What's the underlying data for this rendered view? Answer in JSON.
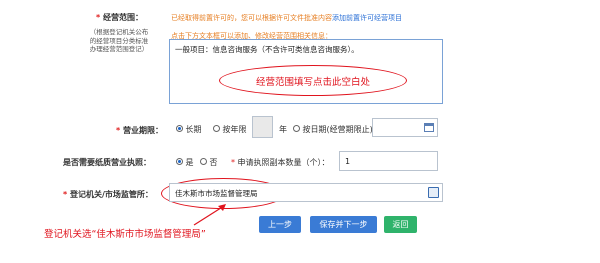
{
  "scope": {
    "label": "经营范围：",
    "note": "已经取得前置许可的，您可以根据许可文件批准内容",
    "note_link": "添加前置许可经营项目",
    "hint": "点击下方文本框可以添加、修改经营范围相关信息：",
    "side_tips": [
      "（根据登记机关公布",
      "的经营项目分类标准",
      "办理经营范围登记）"
    ],
    "content": "一般项目：信息咨询服务（不含许可类信息咨询服务）。",
    "callout": "经营范围填写点击此空白处"
  },
  "term": {
    "label": "营业期限：",
    "options": [
      "长期",
      "按年限",
      "年",
      "按日期(经营期限止)"
    ],
    "selected": "长期",
    "calendar_icon": "calendar-icon"
  },
  "paper_license": {
    "label": "是否需要纸质营业执照：",
    "options": [
      "是",
      "否"
    ],
    "selected": "是",
    "count_label": "申请执照副本数量（个）：",
    "count_value": "1"
  },
  "authority": {
    "label": "登记机关/市场监管所：",
    "value": "佳木斯市市场监督管理局",
    "picker_icon": "picker-icon",
    "callout": "登记机关选“佳木斯市市场监督管理局”"
  },
  "buttons": {
    "prev": "上一步",
    "save_next": "保存并下一步",
    "back": "返回"
  },
  "colors": {
    "annotation": "#e0141e",
    "accent": "#3a7bd5",
    "back_button": "#2fb36b",
    "note": "#e67e22"
  }
}
